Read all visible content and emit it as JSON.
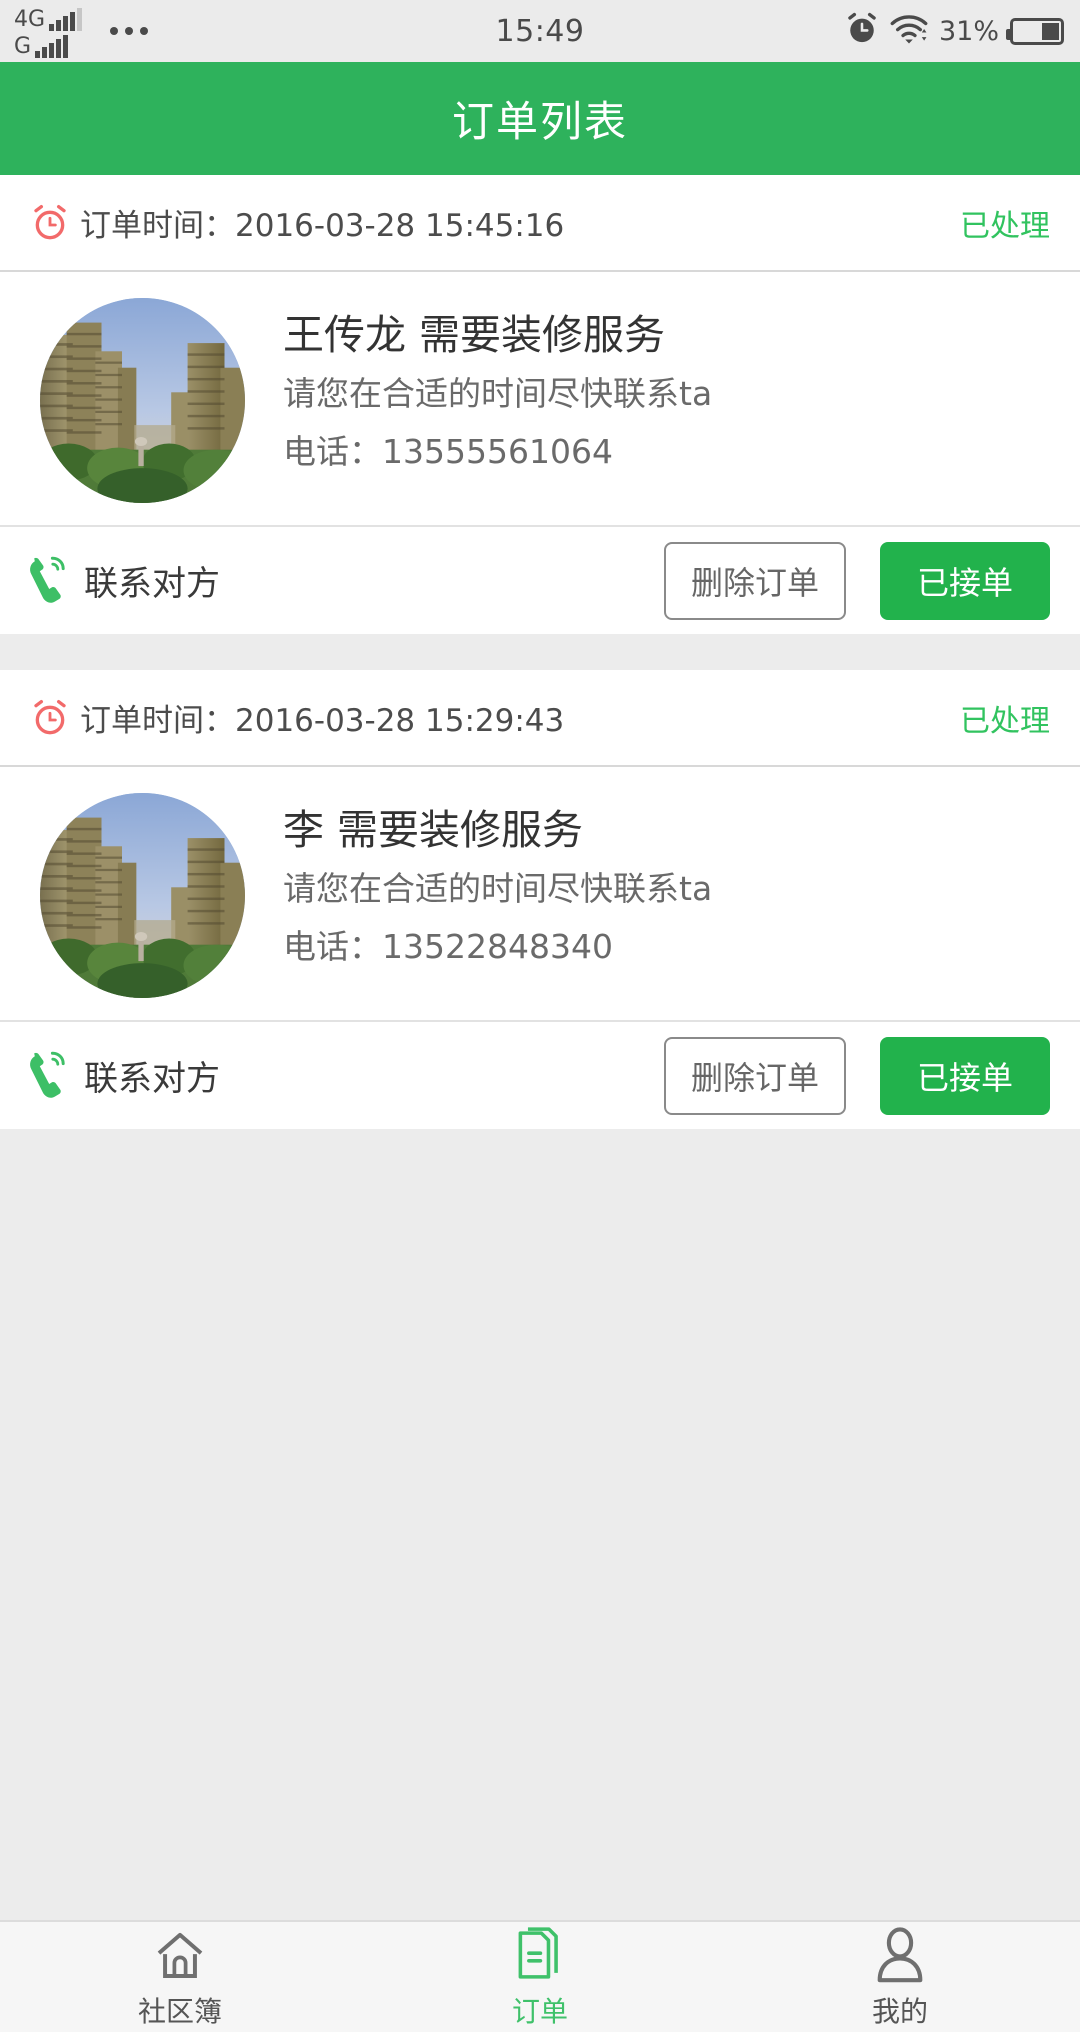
{
  "statusbar": {
    "sim1_label": "4G",
    "sim1_bars": 5,
    "sim1_active": 4,
    "sim2_label": "G",
    "sim2_bars": 5,
    "sim2_active": 5,
    "overflow_icon": "more-dots-icon",
    "time": "15:49",
    "alarm_icon": "alarm-clock-icon",
    "wifi_icon": "wifi-icon",
    "battery_percent": "31%",
    "battery_icon": "battery-icon"
  },
  "navbar": {
    "title": "订单列表"
  },
  "orders": [
    {
      "time_icon": "alarm-clock-icon",
      "time_label": "订单时间：2016-03-28 15:45:16",
      "status": "已处理",
      "avatar_icon": "apartment-building-avatar",
      "customer_title": "王传龙 需要装修服务",
      "note": "请您在合适的时间尽快联系ta",
      "phone": "电话：13555561064",
      "contact_icon": "phone-handset-icon",
      "contact_label": "联系对方",
      "delete_label": "删除订单",
      "accept_label": "已接单"
    },
    {
      "time_icon": "alarm-clock-icon",
      "time_label": "订单时间：2016-03-28 15:29:43",
      "status": "已处理",
      "avatar_icon": "apartment-building-avatar",
      "customer_title": "李 需要装修服务",
      "note": "请您在合适的时间尽快联系ta",
      "phone": "电话：13522848340",
      "contact_icon": "phone-handset-icon",
      "contact_label": "联系对方",
      "delete_label": "删除订单",
      "accept_label": "已接单"
    }
  ],
  "tabbar": {
    "items": [
      {
        "label": "社区簿",
        "icon": "home-icon",
        "active": false
      },
      {
        "label": "订单",
        "icon": "document-icon",
        "active": true
      },
      {
        "label": "我的",
        "icon": "person-icon",
        "active": false
      }
    ]
  },
  "colors": {
    "brand_green": "#2eb25c",
    "accent_green": "#22b24c",
    "status_green": "#31c35f",
    "clock_red": "#f26a6a",
    "page_bg": "#ececec",
    "statusbar_bg": "#ebebeb"
  }
}
